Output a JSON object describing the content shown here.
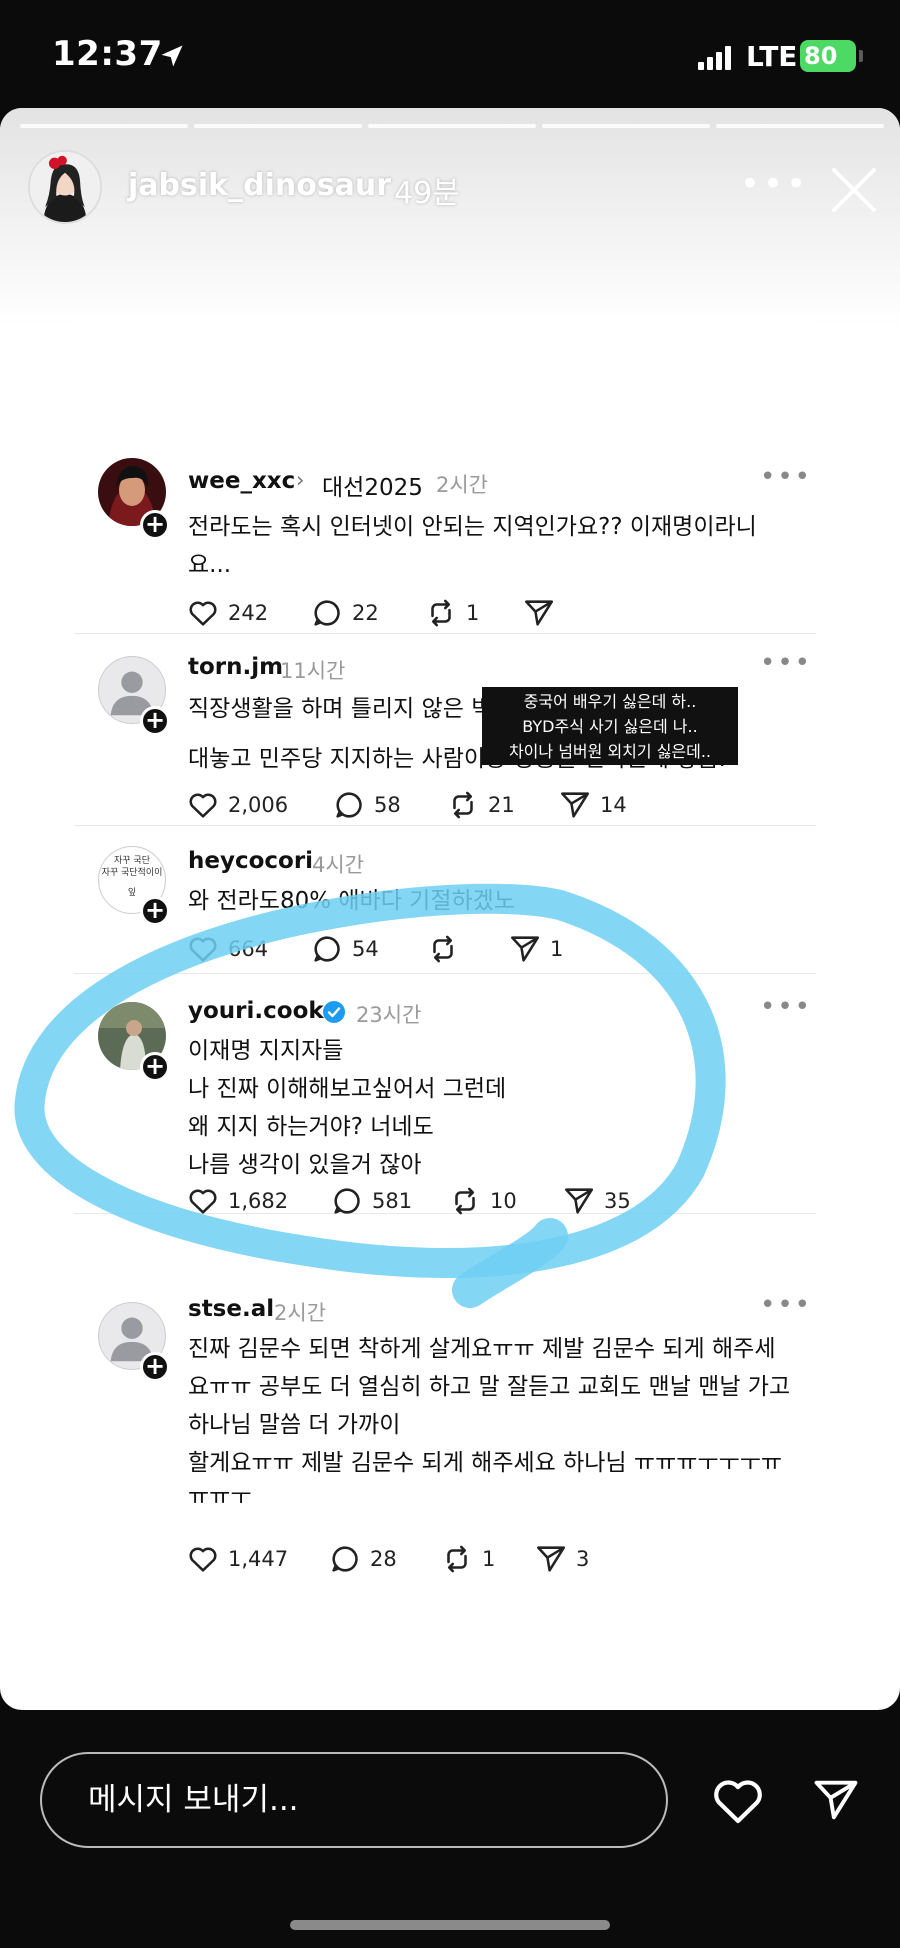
{
  "status_bar": {
    "time": "12:37",
    "network": "LTE",
    "battery": "80"
  },
  "story": {
    "username": "jabsik_dinosaur",
    "time_ago": "49분",
    "more_icon": "more-icon",
    "close_icon": "close-icon"
  },
  "posts": [
    {
      "username": "wee_xxc",
      "topic": "대선2025",
      "time": "2시간",
      "lines": [
        "전라도는 혹시 인터넷이 안되는 지역인가요?? 이재명이라니",
        "요..."
      ],
      "likes": "242",
      "comments": "22",
      "reposts": "1",
      "shares": ""
    },
    {
      "username": "torn.jm",
      "time": "11시간",
      "lines": [
        "직장생활을 하며 틀리지 않은 빅데이터 하나",
        "대놓고 민주당 지지하는 사람이랑 상종을 안하는게 좋음."
      ],
      "likes": "2,006",
      "comments": "58",
      "reposts": "21",
      "shares": "14"
    },
    {
      "username": "heycocori",
      "time": "4시간",
      "lines": [
        "와 전라도80% 애바다 기절하겠노"
      ],
      "likes": "664",
      "comments": "54",
      "reposts": "",
      "shares": "1"
    },
    {
      "username": "youri.cook",
      "time": "23시간",
      "verified": true,
      "lines": [
        "이재명 지지자들",
        "나 진짜 이해해보고싶어서 그런데",
        "왜 지지 하는거야? 너네도",
        " 나름 생각이 있을거 잖아"
      ],
      "likes": "1,682",
      "comments": "581",
      "reposts": "10",
      "shares": "35"
    },
    {
      "username": "stse.al",
      "time": "2시간",
      "lines": [
        "진짜 김문수 되면 착하게 살게요ㅠㅠ 제발 김문수 되게 해주세",
        "요ㅠㅠ 공부도 더 열심히 하고 말 잘듣고 교회도 맨날 맨날 가고",
        "하나님 말씀 더 가까이",
        "할게요ㅠㅠ 제발 김문수 되게 해주세요 하나님 ㅠㅠㅠㅜㅜㅜㅠ",
        "ㅠㅠㅜ"
      ],
      "likes": "1,447",
      "comments": "28",
      "reposts": "1",
      "shares": "3"
    }
  ],
  "overlay_caption": [
    "중국어 배우기 싫은데 하..",
    "BYD주식 사기 싫은데 나..",
    "차이나 넘버원 외치기 싫은데.."
  ],
  "heycocori_avatar_text": [
    "자꾸 국단",
    "자꾸 국단적이이",
    "잎"
  ],
  "message_bar": {
    "placeholder": "메시지 보내기..."
  },
  "colors": {
    "highlight_stroke": "#6fcff3",
    "verified": "#1d9bf0",
    "battery": "#4cd964"
  }
}
